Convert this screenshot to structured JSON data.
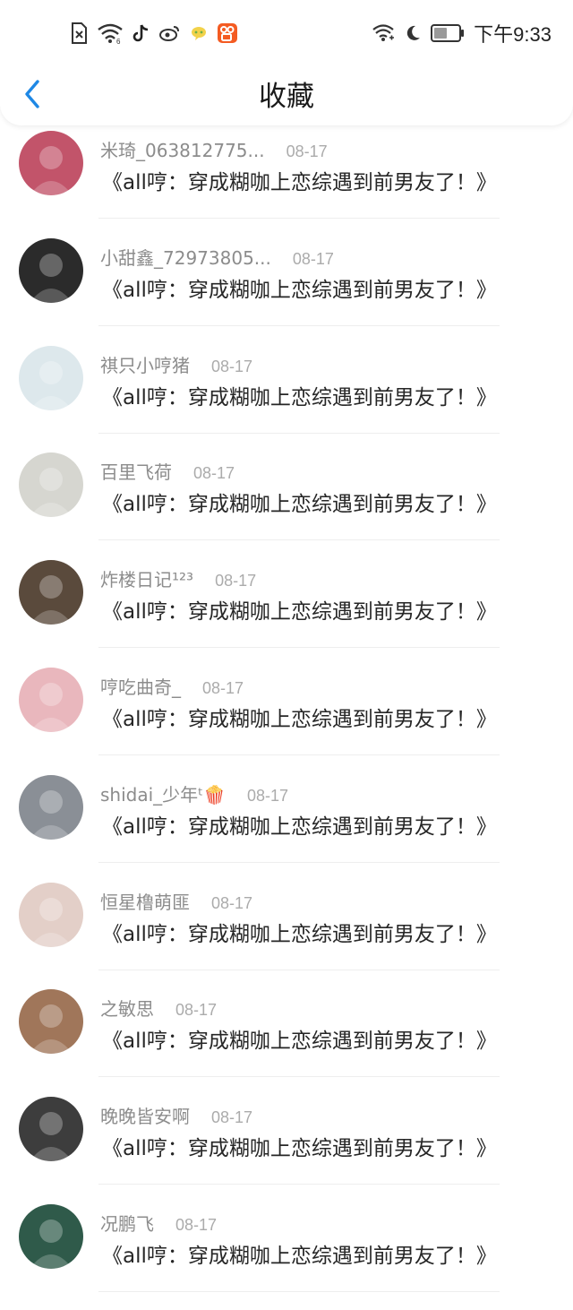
{
  "status_bar": {
    "time": "下午9:33",
    "left_icons": [
      "sim-off-icon",
      "wifi-signal-icon",
      "tiktok-icon",
      "weibo-icon",
      "chat-bubble-icon",
      "kuaishou-icon"
    ],
    "right_icons": [
      "wifi-icon",
      "moon-icon",
      "battery-icon"
    ]
  },
  "header": {
    "title": "收藏",
    "back_icon": "chevron-left-icon",
    "accent_color": "#1e88e5"
  },
  "items": [
    {
      "username": "米琦_063812775...",
      "date": "08-17",
      "content": "《all哼：穿成糊咖上恋综遇到前男友了！》",
      "avatar_color": "#c2546a"
    },
    {
      "username": "小甜鑫_72973805...",
      "date": "08-17",
      "content": "《all哼：穿成糊咖上恋综遇到前男友了！》",
      "avatar_color": "#2b2b2b"
    },
    {
      "username": "祺只小哼猪",
      "date": "08-17",
      "content": "《all哼：穿成糊咖上恋综遇到前男友了！》",
      "avatar_color": "#dde8ec"
    },
    {
      "username": "百里飞荷",
      "date": "08-17",
      "content": "《all哼：穿成糊咖上恋综遇到前男友了！》",
      "avatar_color": "#d6d6d0"
    },
    {
      "username": "炸楼日记¹²³",
      "date": "08-17",
      "content": "《all哼：穿成糊咖上恋综遇到前男友了！》",
      "avatar_color": "#5a4a3c"
    },
    {
      "username": "哼吃曲奇_",
      "date": "08-17",
      "content": "《all哼：穿成糊咖上恋综遇到前男友了！》",
      "avatar_color": "#e9b7bd"
    },
    {
      "username": "shidai_少年ᵗ🍿",
      "date": "08-17",
      "content": "《all哼：穿成糊咖上恋综遇到前男友了！》",
      "avatar_color": "#8a8f96"
    },
    {
      "username": "恒星橹萌匪",
      "date": "08-17",
      "content": "《all哼：穿成糊咖上恋综遇到前男友了！》",
      "avatar_color": "#e3cfc8"
    },
    {
      "username": "之敏思",
      "date": "08-17",
      "content": "《all哼：穿成糊咖上恋综遇到前男友了！》",
      "avatar_color": "#a0765a"
    },
    {
      "username": "晚晚皆安啊",
      "date": "08-17",
      "content": "《all哼：穿成糊咖上恋综遇到前男友了！》",
      "avatar_color": "#3d3d3d"
    },
    {
      "username": "况鹏飞",
      "date": "08-17",
      "content": "《all哼：穿成糊咖上恋综遇到前男友了！》",
      "avatar_color": "#2f5a4a"
    }
  ]
}
